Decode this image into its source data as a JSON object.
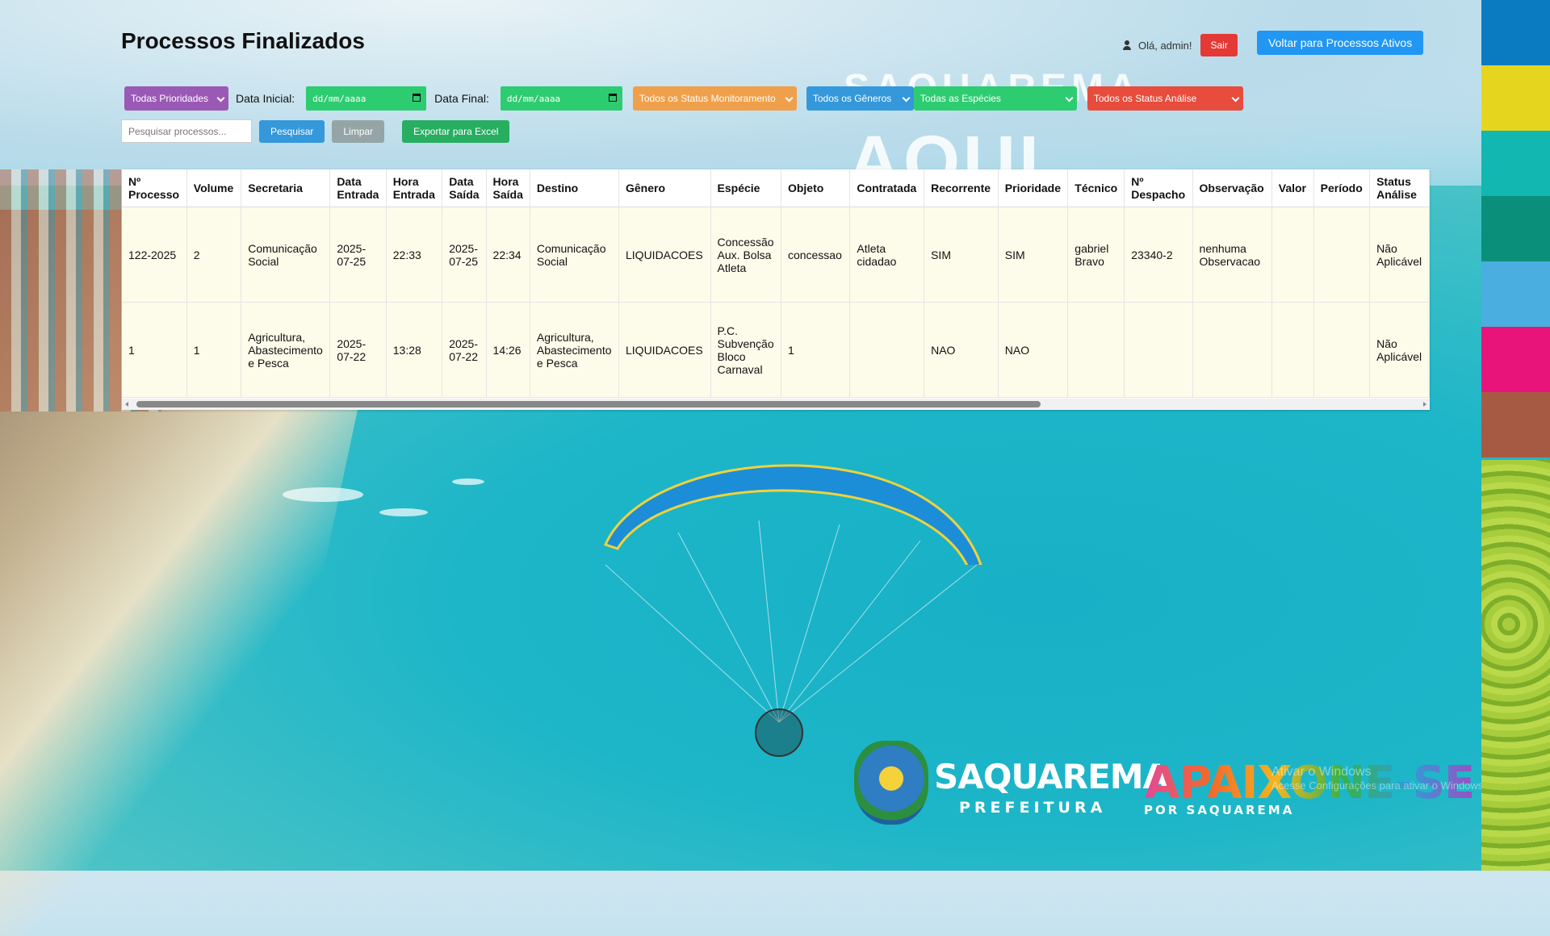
{
  "header": {
    "title": "Processos Finalizados",
    "greeting": "Olá, admin!",
    "logout_label": "Sair",
    "back_label": "Voltar para Processos Ativos"
  },
  "filters": {
    "priority": "Todas Prioridades",
    "start_date_label": "Data Inicial:",
    "start_date_value": "dd/mm/aaaa",
    "end_date_label": "Data Final:",
    "end_date_value": "dd/mm/aaaa",
    "monitoring_status": "Todos os Status Monitoramento",
    "genres": "Todos os Gêneros",
    "species": "Todas as Espécies",
    "analysis_status": "Todos os Status Análise"
  },
  "search": {
    "placeholder": "Pesquisar processos...",
    "search_label": "Pesquisar",
    "clear_label": "Limpar",
    "export_label": "Exportar para Excel"
  },
  "table": {
    "columns": [
      "Nº Processo",
      "Volume",
      "Secretaria",
      "Data Entrada",
      "Hora Entrada",
      "Data Saída",
      "Hora Saída",
      "Destino",
      "Gênero",
      "Espécie",
      "Objeto",
      "Contratada",
      "Recorrente",
      "Prioridade",
      "Técnico",
      "Nº Despacho",
      "Observação",
      "Valor",
      "Período",
      "Status Análise"
    ],
    "rows": [
      [
        "122-2025",
        "2",
        "Comunicação Social",
        "2025-07-25",
        "22:33",
        "2025-07-25",
        "22:34",
        "Comunicação Social",
        "LIQUIDACOES",
        "Concessão Aux. Bolsa Atleta",
        "concessao",
        "Atleta cidadao",
        "SIM",
        "SIM",
        "gabriel Bravo",
        "23340-2",
        "nenhuma Observacao",
        "",
        "",
        "Não Aplicável"
      ],
      [
        "1",
        "1",
        "Agricultura, Abastecimento e Pesca",
        "2025-07-22",
        "13:28",
        "2025-07-22",
        "14:26",
        "Agricultura, Abastecimento e Pesca",
        "LIQUIDACOES",
        "P.C. Subvenção Bloco Carnaval",
        "1",
        "",
        "NAO",
        "NAO",
        "",
        "",
        "",
        "",
        "",
        "Não Aplicável"
      ]
    ]
  },
  "background": {
    "deco_top": "SAQUAREMA",
    "deco_big": "AQUI",
    "logo_name": "SAQUAREMA",
    "logo_sub": "PREFEITURA",
    "slogan": "APAIXONE-SE",
    "slogan_sub": "POR SAQUAREMA",
    "os_watermark": "Ativar o Windows",
    "os_watermark_sub": "Acesse Configurações para ativar o Windows."
  },
  "colors": {
    "priority": "#9b59b6",
    "date": "#2ecc71",
    "monitoring": "#f0a04b",
    "genres": "#3498db",
    "species": "#2ecc71",
    "analysis": "#e74c3c",
    "search_btn": "#3498db",
    "clear_btn": "#95a5a6",
    "export_btn": "#27ae60",
    "strip": [
      "#0a7bc1",
      "#e6d51f",
      "#11b7b0",
      "#0a8f7a",
      "#4aaee0",
      "#e8147a",
      "#a75a43"
    ]
  }
}
